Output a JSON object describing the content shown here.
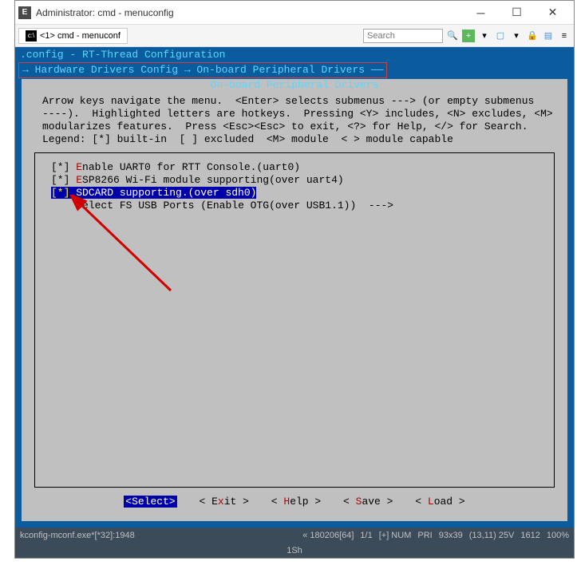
{
  "window": {
    "title": "Administrator: cmd - menuconfig"
  },
  "tab": {
    "label": "<1> cmd - menuconf"
  },
  "search": {
    "placeholder": "Search"
  },
  "terminal": {
    "config_line": ".config - RT-Thread Configuration",
    "breadcrumb": "→ Hardware Drivers Config → On-board Peripheral Drivers ——",
    "section_title": "On-board Peripheral Drivers",
    "help_text": "Arrow keys navigate the menu.  <Enter> selects submenus ---> (or empty submenus\n----).  Highlighted letters are hotkeys.  Pressing <Y> includes, <N> excludes, <M>\nmodularizes features.  Press <Esc><Esc> to exit, <?> for Help, </> for Search.\nLegend: [*] built-in  [ ] excluded  <M> module  < > module capable"
  },
  "menu_items": [
    {
      "bracket": "[*]",
      "hotkey": "E",
      "text": "nable UART0 for RTT Console.(uart0)",
      "selected": false
    },
    {
      "bracket": "[*]",
      "hotkey": "E",
      "text": "SP8266 Wi-Fi module supporting(over uart4)",
      "selected": false
    },
    {
      "bracket": "[*]",
      "hotkey": "",
      "text": " SDCARD supporting.(over sdh0)",
      "selected": true
    },
    {
      "bracket": "   ",
      "hotkey": "S",
      "text": "elect FS USB Ports (Enable OTG(over USB1.1))  --->",
      "selected": false
    }
  ],
  "buttons": {
    "select": "<Select>",
    "exit_open": "< E",
    "exit_key": "x",
    "exit_close": "it >",
    "help_open": "< ",
    "help_key": "H",
    "help_close": "elp >",
    "save_open": "< ",
    "save_key": "S",
    "save_close": "ave >",
    "load_open": "< ",
    "load_key": "L",
    "load_close": "oad >"
  },
  "statusbar": {
    "process": "kconfig-mconf.exe*[*32]:1948",
    "encoding": "« 180206[64]",
    "position": "1/1",
    "mode": "[+] NUM",
    "pri": "PRI",
    "size": "93x39",
    "cursor": "(13,11) 25V",
    "mem": "1612",
    "pct": "100%",
    "line2": "1Sh"
  }
}
